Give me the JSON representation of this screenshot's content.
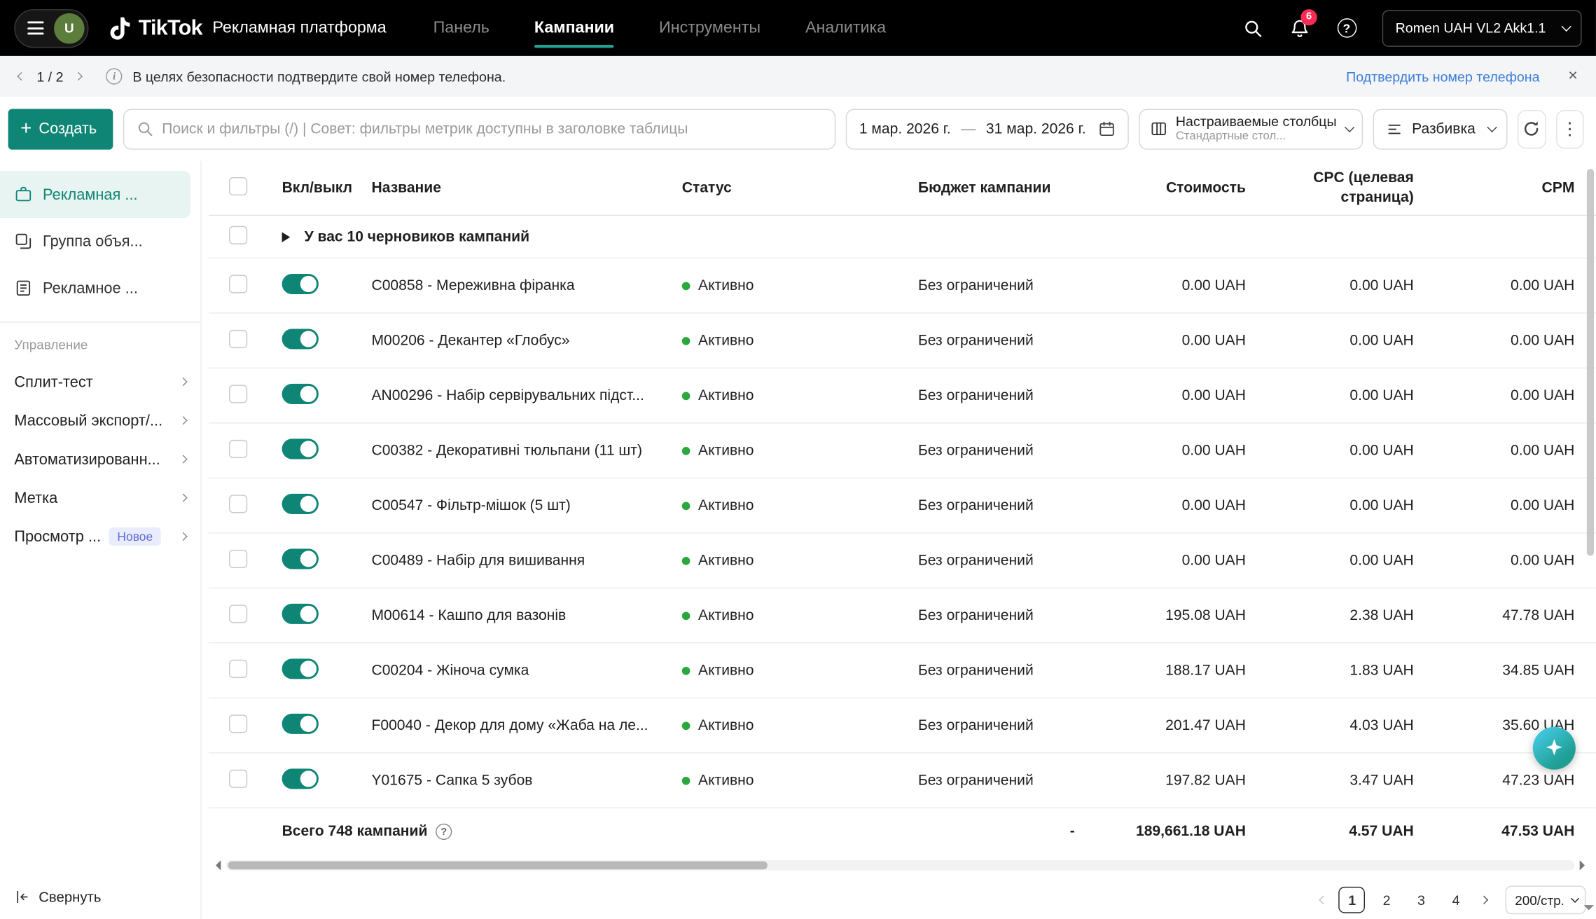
{
  "theme": {
    "primary": "#0f8575",
    "primary-light": "#e7f4f1",
    "underline": "#1fa390",
    "link": "#3d7dd8",
    "green": "#2ba83d",
    "red": "#fe2c55",
    "badge-bg": "#e9ecfd",
    "badge-text": "#5f6bd8",
    "avatar": "#5c7d3b"
  },
  "topbar": {
    "brand": "TikTok",
    "brand_suffix": "Рекламная платформа",
    "avatar_initial": "U",
    "nav": [
      {
        "label": "Панель"
      },
      {
        "label": "Кампании"
      },
      {
        "label": "Инструменты"
      },
      {
        "label": "Аналитика"
      }
    ],
    "notification_count": "6",
    "help_glyph": "?",
    "account": "Romen UAH VL2 Akk1.1"
  },
  "banner": {
    "pager": "1 / 2",
    "info_glyph": "i",
    "message": "В целях безопасности подтвердите свой номер телефона.",
    "action": "Подтвердить номер телефона",
    "close_glyph": "×"
  },
  "toolbar": {
    "create_label": "Создать",
    "plus_glyph": "+",
    "search_placeholder": "Поиск и фильтры (/) | Совет: фильтры метрик доступны в заголовке таблицы",
    "date_start": "1 мар. 2026 г.",
    "date_separator": "—",
    "date_end": "31 мар. 2026 г.",
    "columns_label": "Настраиваемые столбцы",
    "columns_sublabel": "Стандартные стол...",
    "breakdown_label": "Разбивка",
    "more_glyph": "⋮"
  },
  "sidebar": {
    "entities": [
      {
        "label": "Рекламная ..."
      },
      {
        "label": "Группа объя..."
      },
      {
        "label": "Рекламное ..."
      }
    ],
    "section_label": "Управление",
    "management": [
      {
        "label": "Сплит-тест"
      },
      {
        "label": "Массовый экспорт/..."
      },
      {
        "label": "Автоматизированн..."
      },
      {
        "label": "Метка"
      },
      {
        "label": "Просмотр ...",
        "badge": "Новое"
      }
    ],
    "collapse_label": "Свернуть"
  },
  "table": {
    "headers": [
      "Вкл/выкл",
      "Название",
      "Статус",
      "Бюджет кампании",
      "Стоимость",
      "CPC (целевая страница)",
      "CPM"
    ],
    "drafts_row": "У вас 10 черновиков кампаний",
    "rows": [
      {
        "name": "C00858 - Мереживна фіранка",
        "status": "Активно",
        "budget": "Без ограничений",
        "cost": "0.00 UAH",
        "cpc": "0.00 UAH",
        "cpm": "0.00 UAH"
      },
      {
        "name": "M00206 - Декантер «Глобус»",
        "status": "Активно",
        "budget": "Без ограничений",
        "cost": "0.00 UAH",
        "cpc": "0.00 UAH",
        "cpm": "0.00 UAH"
      },
      {
        "name": "AN00296 - Набір сервірувальних підст...",
        "status": "Активно",
        "budget": "Без ограничений",
        "cost": "0.00 UAH",
        "cpc": "0.00 UAH",
        "cpm": "0.00 UAH"
      },
      {
        "name": "C00382 - Декоративні тюльпани (11 шт)",
        "status": "Активно",
        "budget": "Без ограничений",
        "cost": "0.00 UAH",
        "cpc": "0.00 UAH",
        "cpm": "0.00 UAH"
      },
      {
        "name": "C00547 - Фільтр-мішок (5 шт)",
        "status": "Активно",
        "budget": "Без ограничений",
        "cost": "0.00 UAH",
        "cpc": "0.00 UAH",
        "cpm": "0.00 UAH"
      },
      {
        "name": "C00489 - Набір для вишивання",
        "status": "Активно",
        "budget": "Без ограничений",
        "cost": "0.00 UAH",
        "cpc": "0.00 UAH",
        "cpm": "0.00 UAH"
      },
      {
        "name": "M00614 - Кашпо для вазонів",
        "status": "Активно",
        "budget": "Без ограничений",
        "cost": "195.08 UAH",
        "cpc": "2.38 UAH",
        "cpm": "47.78 UAH"
      },
      {
        "name": "C00204 - Жіноча сумка",
        "status": "Активно",
        "budget": "Без ограничений",
        "cost": "188.17 UAH",
        "cpc": "1.83 UAH",
        "cpm": "34.85 UAH"
      },
      {
        "name": "F00040 - Декор для дому «Жаба на ле...",
        "status": "Активно",
        "budget": "Без ограничений",
        "cost": "201.47 UAH",
        "cpc": "4.03 UAH",
        "cpm": "35.60 UAH"
      },
      {
        "name": "Y01675 - Сапка 5 зубов",
        "status": "Активно",
        "budget": "Без ограничений",
        "cost": "197.82 UAH",
        "cpc": "3.47 UAH",
        "cpm": "47.23 UAH"
      }
    ],
    "footer": {
      "label": "Всего 748 кампаний",
      "help_glyph": "?",
      "budget": "-",
      "cost": "189,661.18 UAH",
      "cpc": "4.57 UAH",
      "cpm": "47.53 UAH"
    }
  },
  "pagination": {
    "pages": [
      "1",
      "2",
      "3",
      "4"
    ],
    "active_page": "1",
    "page_size": "200/стр."
  }
}
